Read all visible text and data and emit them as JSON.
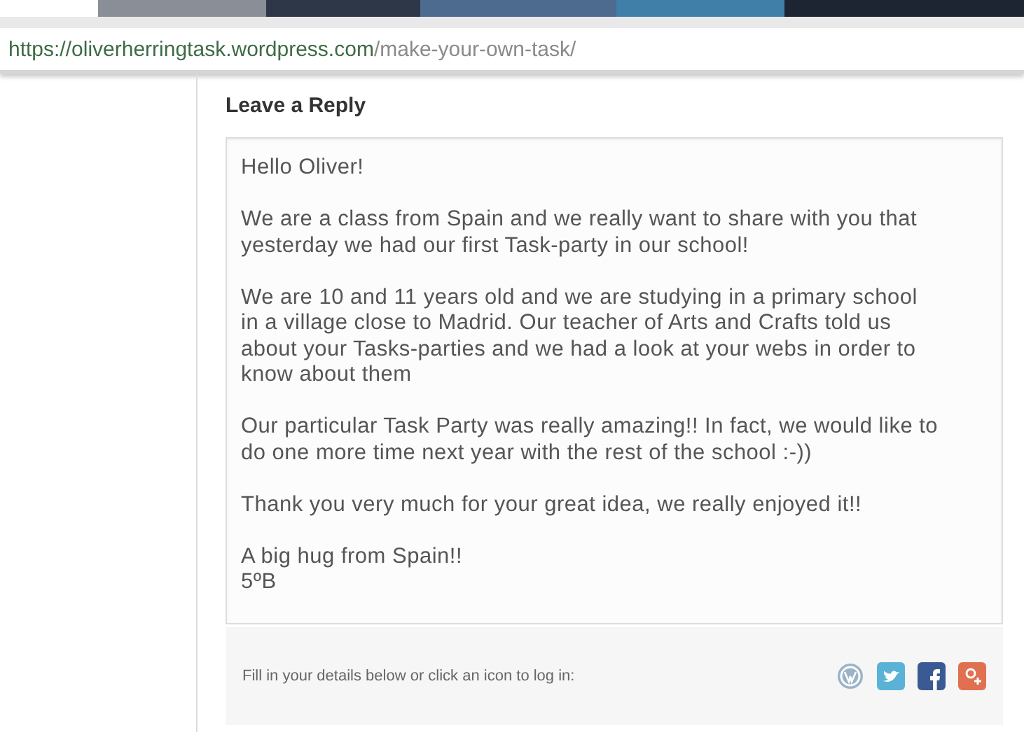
{
  "address_bar": {
    "url_host": "https://oliverherringtask.wordpress.com",
    "url_path": "/make-your-own-task/"
  },
  "reply": {
    "heading": "Leave a Reply",
    "message": [
      {
        "lines": [
          "Hello Oliver!"
        ]
      },
      {
        "lines": [
          "We are a class from Spain and we really want to share with you that",
          "yesterday we had our first Task-party in our school!"
        ]
      },
      {
        "lines": [
          "We are 10 and 11 years old and we are studying in a primary school",
          "in a village close to Madrid. Our teacher of Arts and Crafts told us",
          "about your Tasks-parties and we had a look at your webs in order to",
          "know about them"
        ]
      },
      {
        "lines": [
          "Our particular Task Party was really amazing!! In fact, we would like to",
          "do one more time next year with the rest of the school :-))"
        ]
      },
      {
        "lines": [
          "Thank you very much for your great idea, we really enjoyed it!!"
        ]
      },
      {
        "lines": [
          "A big hug from Spain!!",
          "5ºB"
        ]
      }
    ],
    "login_hint": "Fill in your details below or click an icon to log in:",
    "login_icons": [
      {
        "kind": "wordpress"
      },
      {
        "kind": "twitter"
      },
      {
        "kind": "facebook"
      },
      {
        "kind": "googleplus"
      }
    ]
  }
}
